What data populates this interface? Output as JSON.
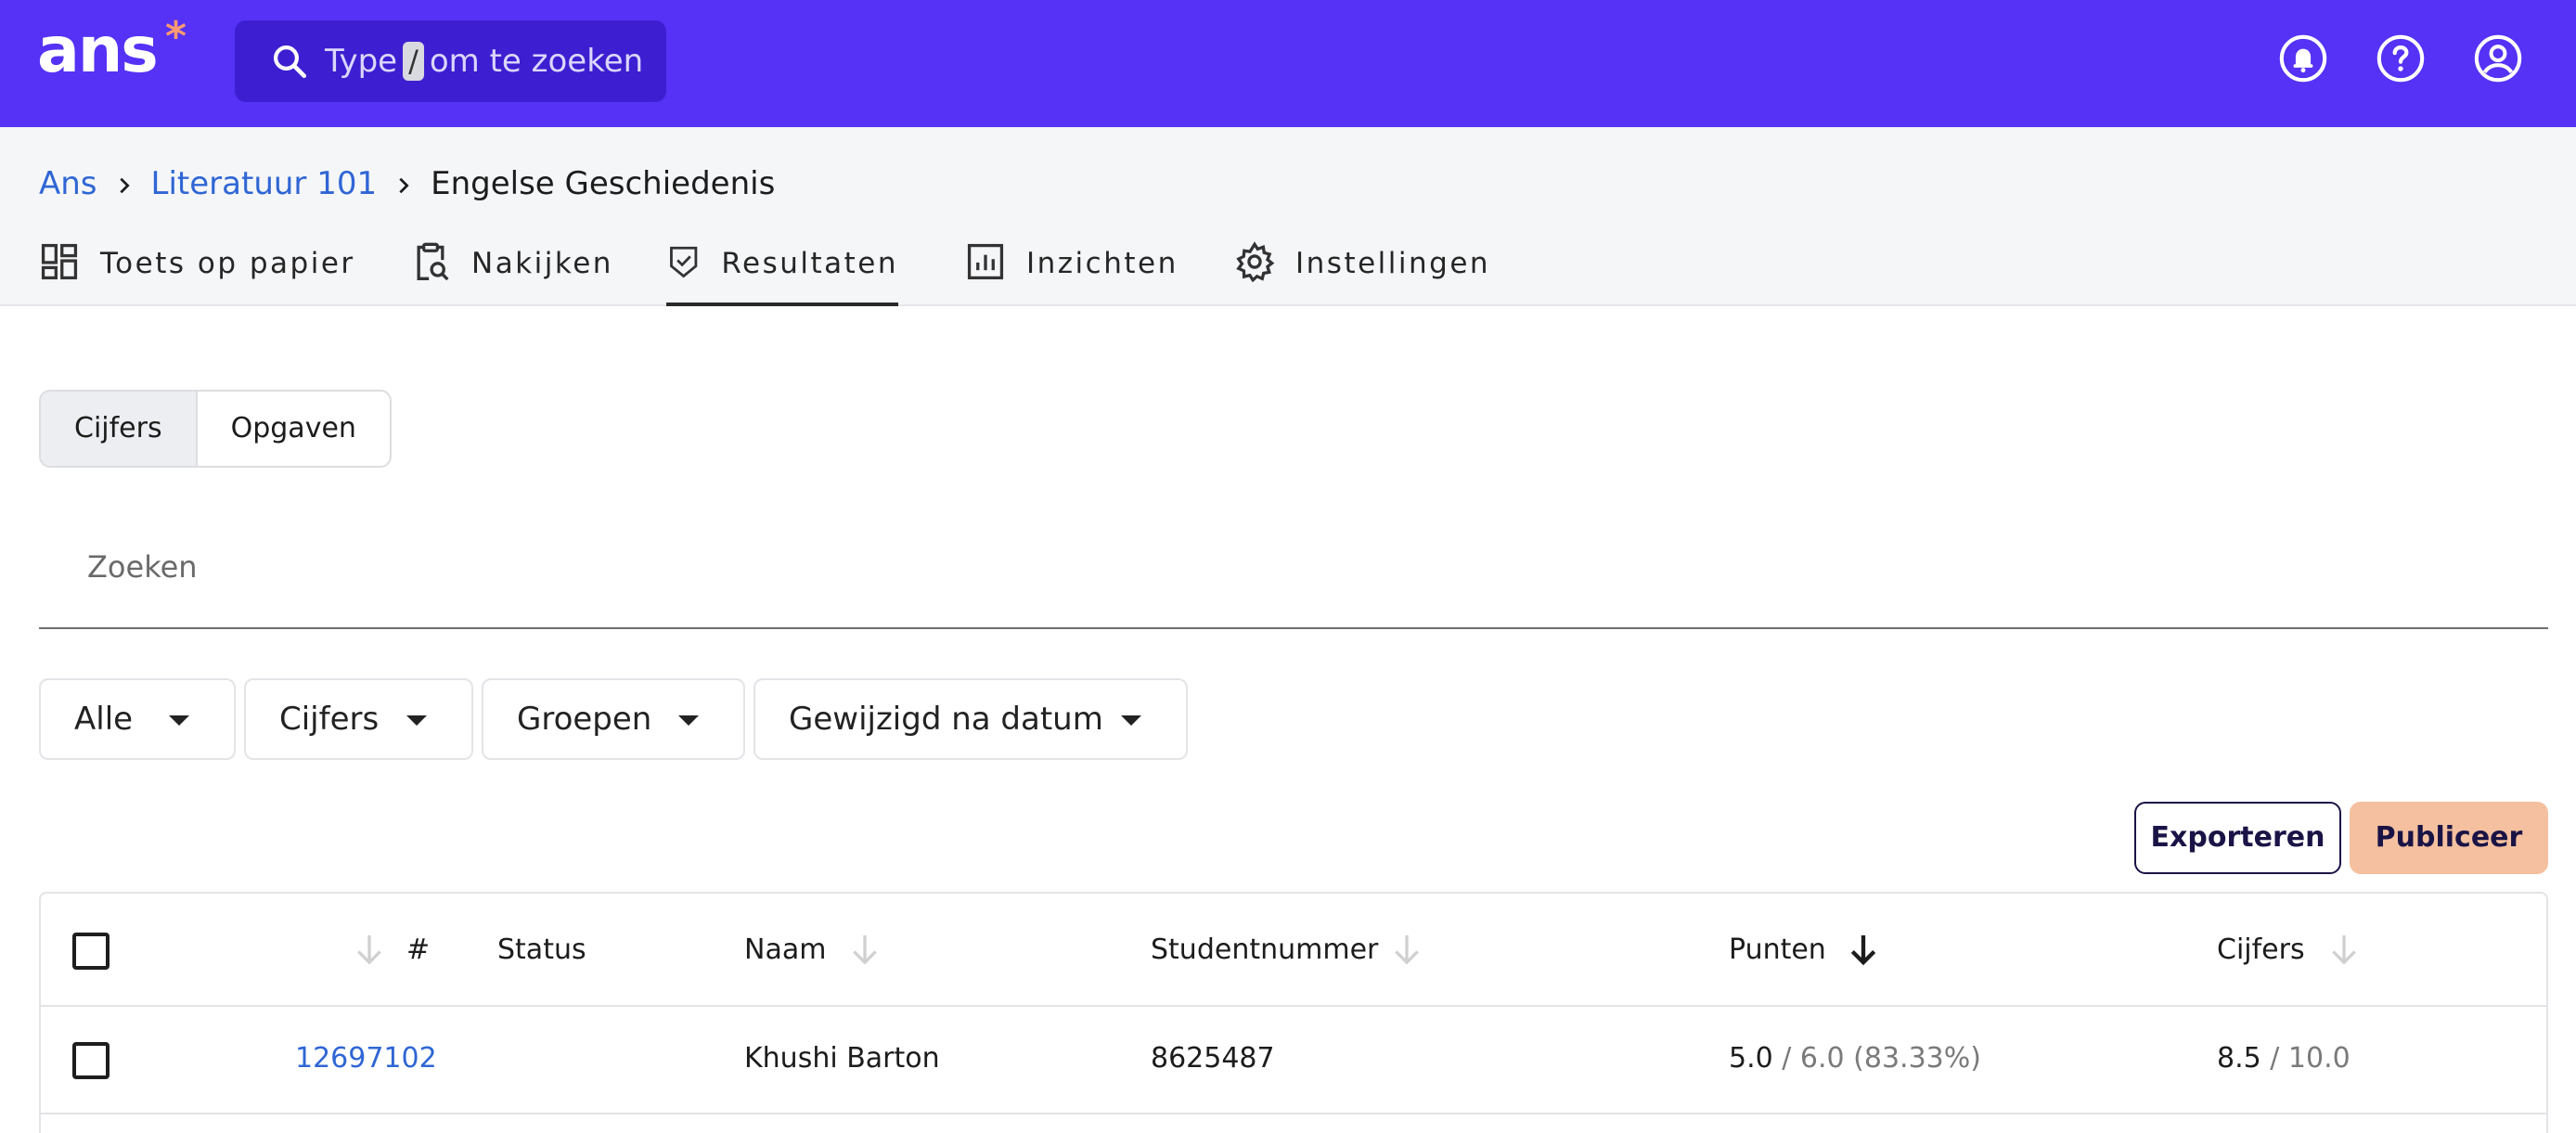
{
  "topbar": {
    "logo": "ans",
    "logo_star": "*",
    "search": {
      "prefix": "Type",
      "key": "/",
      "suffix": "om te zoeken"
    },
    "icons": [
      "bell-icon",
      "help-icon",
      "user-icon"
    ]
  },
  "breadcrumb": [
    {
      "label": "Ans"
    },
    {
      "label": "Literatuur 101"
    },
    {
      "label": "Engelse Geschiedenis"
    }
  ],
  "tabs": [
    {
      "label": "Toets op papier",
      "icon": "dashboard-icon"
    },
    {
      "label": "Nakijken",
      "icon": "clipboard-search-icon"
    },
    {
      "label": "Resultaten",
      "icon": "shield-check-icon",
      "active": true
    },
    {
      "label": "Inzichten",
      "icon": "bar-chart-icon"
    },
    {
      "label": "Instellingen",
      "icon": "gear-icon"
    }
  ],
  "segmented": {
    "options": [
      "Cijfers",
      "Opgaven"
    ],
    "selected": "Cijfers"
  },
  "search_field": {
    "placeholder": "Zoeken"
  },
  "filters": [
    "Alle",
    "Cijfers",
    "Groepen",
    "Gewijzigd na datum"
  ],
  "actions": {
    "export": "Exporteren",
    "publish": "Publiceer"
  },
  "table": {
    "columns": {
      "number": "#",
      "status": "Status",
      "name": "Naam",
      "student_number": "Studentnummer",
      "points": "Punten",
      "grades": "Cijfers"
    },
    "rows": [
      {
        "id": "12697102",
        "status": "",
        "name": "Khushi Barton",
        "student_number": "8625487",
        "points": "5.0",
        "points_rest": "/ 6.0 (83.33%)",
        "grade": "8.5",
        "grade_rest": "/ 10.0"
      }
    ]
  },
  "colors": {
    "topbar": "#5532f5",
    "link": "#2f66d4",
    "publish": "#f4c09f",
    "accent_star": "#ff9a73"
  }
}
